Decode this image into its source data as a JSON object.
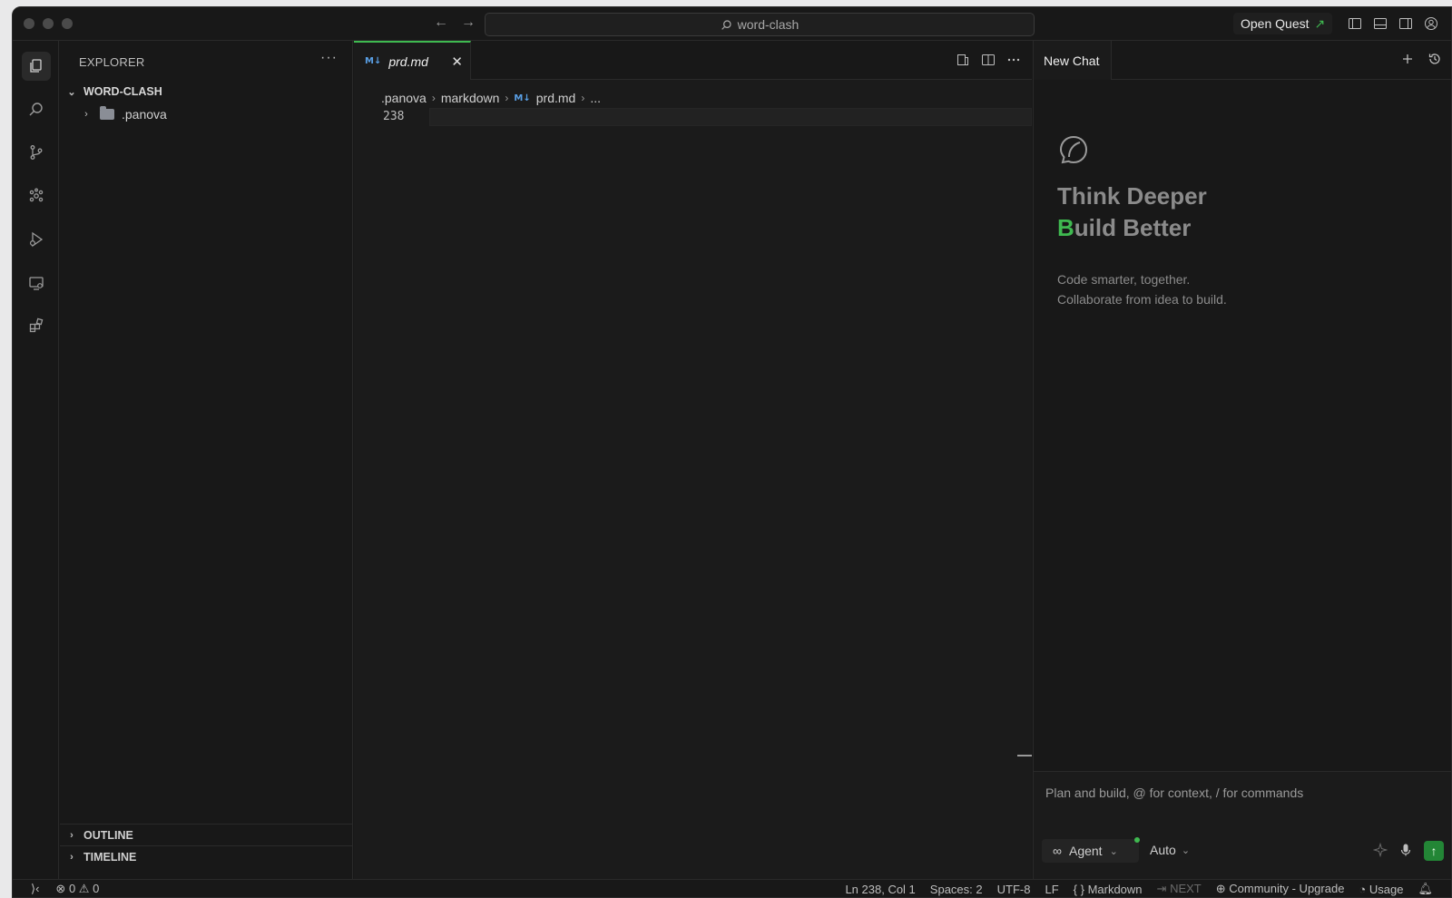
{
  "titlebar": {
    "search_text": "word-clash",
    "open_quest_label": "Open Quest",
    "open_quest_arrow": "↗"
  },
  "sidebar": {
    "title": "EXPLORER",
    "root_folder": "WORD-CLASH",
    "items": [
      {
        "label": ".panova",
        "type": "folder",
        "expanded": false
      }
    ],
    "sections": [
      "OUTLINE",
      "TIMELINE"
    ]
  },
  "editor": {
    "tab": {
      "icon": "M↓",
      "label": "prd.md"
    },
    "breadcrumb": [
      ".panova",
      "markdown",
      "prd.md",
      "..."
    ],
    "line_number": "238"
  },
  "chat": {
    "tab_label": "New Chat",
    "hero_line1": "Think Deeper",
    "hero_line2_first": "B",
    "hero_line2_rest": "uild Better",
    "sub_line1": "Code smarter, together.",
    "sub_line2": "Collaborate from idea to build.",
    "input_placeholder": "Plan and build, @ for context, / for commands",
    "agent_label": "Agent",
    "model_label": "Auto"
  },
  "statusbar": {
    "errors": "0",
    "warnings": "0",
    "position": "Ln 238, Col 1",
    "spaces": "Spaces: 2",
    "encoding": "UTF-8",
    "eol": "LF",
    "language": "Markdown",
    "next": "NEXT",
    "plan": "Community - Upgrade",
    "usage": "Usage"
  },
  "colors": {
    "accent": "#3fb950",
    "background": "#181818",
    "markdown_icon": "#5aa0e6"
  },
  "icons": {
    "activity_bar": [
      "files-icon",
      "search-icon",
      "source-control-icon",
      "extensions-cluster-icon",
      "run-debug-icon",
      "remote-explorer-icon",
      "extensions-icon"
    ]
  }
}
